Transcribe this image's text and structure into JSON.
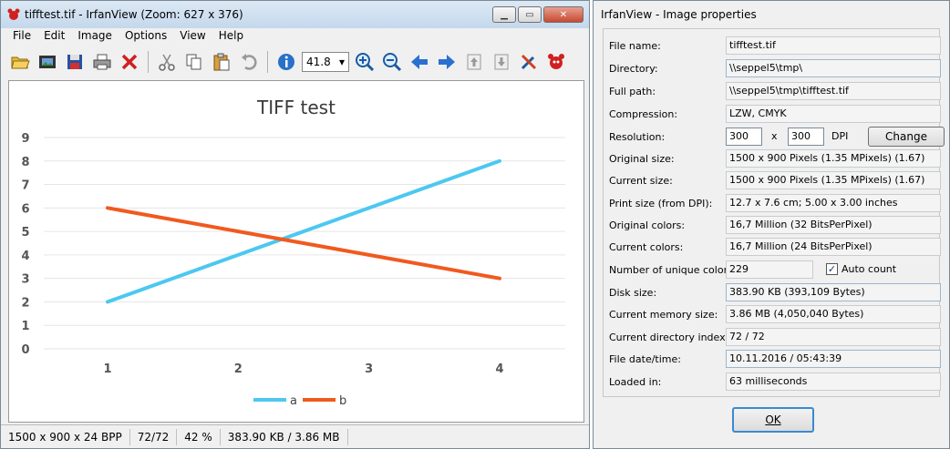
{
  "main_window": {
    "title": "tifftest.tif - IrfanView (Zoom: 627 x 376)",
    "menu": [
      "File",
      "Edit",
      "Image",
      "Options",
      "View",
      "Help"
    ],
    "zoom_value": "41.8",
    "status": {
      "dimensions": "1500 x 900 x 24 BPP",
      "index": "72/72",
      "zoom": "42 %",
      "size": "383.90 KB / 3.86 MB"
    }
  },
  "chart_data": {
    "type": "line",
    "title": "TIFF test",
    "categories": [
      "1",
      "2",
      "3",
      "4"
    ],
    "y_ticks": [
      "0",
      "1",
      "2",
      "3",
      "4",
      "5",
      "6",
      "7",
      "8",
      "9"
    ],
    "ylim": [
      0,
      9
    ],
    "series": [
      {
        "name": "a",
        "values": [
          2,
          4,
          6,
          8
        ],
        "color": "#4cc8f0"
      },
      {
        "name": "b",
        "values": [
          6,
          5,
          4,
          3
        ],
        "color": "#f05a1e"
      }
    ],
    "legend": "bottom",
    "grid": true
  },
  "properties": {
    "title": "IrfanView - Image properties",
    "fields": [
      {
        "label": "File name:",
        "value": "tifftest.tif"
      },
      {
        "label": "Directory:",
        "value": "\\\\seppel5\\tmp\\"
      },
      {
        "label": "Full path:",
        "value": "\\\\seppel5\\tmp\\tifftest.tif"
      },
      {
        "label": "Compression:",
        "value": "LZW, CMYK"
      }
    ],
    "resolution": {
      "label": "Resolution:",
      "x": "300",
      "sep": "x",
      "y": "300",
      "unit": "DPI",
      "change_label": "Change"
    },
    "fields2": [
      {
        "label": "Original size:",
        "value": "1500 x 900  Pixels (1.35 MPixels) (1.67)"
      },
      {
        "label": "Current size:",
        "value": "1500 x 900  Pixels (1.35 MPixels) (1.67)"
      },
      {
        "label": "Print size (from DPI):",
        "value": "12.7 x 7.6 cm; 5.00 x 3.00 inches"
      },
      {
        "label": "Original colors:",
        "value": "16,7 Million   (32 BitsPerPixel)"
      },
      {
        "label": "Current colors:",
        "value": "16,7 Million   (24 BitsPerPixel)"
      }
    ],
    "unique": {
      "label": "Number of unique colors:",
      "value": "229",
      "auto_label": "Auto count"
    },
    "fields3": [
      {
        "label": "Disk size:",
        "value": "383.90 KB (393,109 Bytes)"
      },
      {
        "label": "Current memory size:",
        "value": "3.86  MB (4,050,040 Bytes)"
      },
      {
        "label": "Current directory index:",
        "value": "72  /  72"
      },
      {
        "label": "File date/time:",
        "value": "10.11.2016 / 05:43:39"
      },
      {
        "label": "Loaded in:",
        "value": "63 milliseconds"
      }
    ],
    "ok_label": "OK"
  }
}
